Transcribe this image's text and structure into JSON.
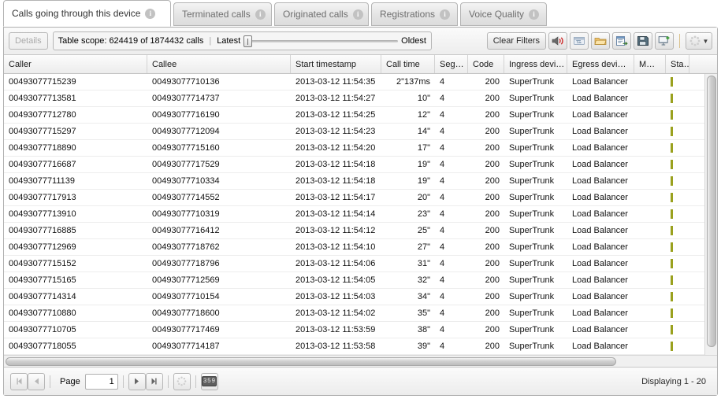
{
  "tabs": [
    {
      "label": "Calls going through this device",
      "active": true,
      "info_icon": "info-icon"
    },
    {
      "label": "Terminated calls",
      "active": false,
      "info_icon": "info-icon"
    },
    {
      "label": "Originated calls",
      "active": false,
      "info_icon": "info-icon"
    },
    {
      "label": "Registrations",
      "active": false,
      "info_icon": "info-icon"
    },
    {
      "label": "Voice Quality",
      "active": false,
      "info_icon": "info-icon"
    }
  ],
  "toolbar": {
    "details_label": "Details",
    "scope_label": "Table scope: 624419 of 1874432 calls",
    "latest_label": "Latest",
    "oldest_label": "Oldest",
    "clear_filters_label": "Clear Filters",
    "icons": [
      "speaker-icon",
      "refresh-print-icon",
      "folder-open-icon",
      "report-export-icon",
      "save-disk-icon",
      "export-chart-icon",
      "settings-spinner-icon"
    ]
  },
  "grid": {
    "columns": [
      {
        "label": "Caller",
        "key": "caller"
      },
      {
        "label": "Callee",
        "key": "callee"
      },
      {
        "label": "Start timestamp",
        "key": "start_timestamp"
      },
      {
        "label": "Call time",
        "key": "call_time"
      },
      {
        "label": "Seg…",
        "key": "segments"
      },
      {
        "label": "Code",
        "key": "code"
      },
      {
        "label": "Ingress devi…",
        "key": "ingress_device"
      },
      {
        "label": "Egress devi…",
        "key": "egress_device"
      },
      {
        "label": "M…",
        "key": "m"
      },
      {
        "label": "Sta…",
        "key": "status"
      }
    ],
    "rows": [
      {
        "caller": "00493077715239",
        "callee": "00493077710136",
        "start_timestamp": "2013-03-12 11:54:35",
        "call_time": "2\"137ms",
        "segments": "4",
        "code": "200",
        "ingress_device": "SuperTrunk",
        "egress_device": "Load Balancer",
        "m": "",
        "status": ""
      },
      {
        "caller": "00493077713581",
        "callee": "00493077714737",
        "start_timestamp": "2013-03-12 11:54:27",
        "call_time": "10\"",
        "segments": "4",
        "code": "200",
        "ingress_device": "SuperTrunk",
        "egress_device": "Load Balancer",
        "m": "",
        "status": ""
      },
      {
        "caller": "00493077712780",
        "callee": "00493077716190",
        "start_timestamp": "2013-03-12 11:54:25",
        "call_time": "12\"",
        "segments": "4",
        "code": "200",
        "ingress_device": "SuperTrunk",
        "egress_device": "Load Balancer",
        "m": "",
        "status": ""
      },
      {
        "caller": "00493077715297",
        "callee": "00493077712094",
        "start_timestamp": "2013-03-12 11:54:23",
        "call_time": "14\"",
        "segments": "4",
        "code": "200",
        "ingress_device": "SuperTrunk",
        "egress_device": "Load Balancer",
        "m": "",
        "status": ""
      },
      {
        "caller": "00493077718890",
        "callee": "00493077715160",
        "start_timestamp": "2013-03-12 11:54:20",
        "call_time": "17\"",
        "segments": "4",
        "code": "200",
        "ingress_device": "SuperTrunk",
        "egress_device": "Load Balancer",
        "m": "",
        "status": ""
      },
      {
        "caller": "00493077716687",
        "callee": "00493077717529",
        "start_timestamp": "2013-03-12 11:54:18",
        "call_time": "19\"",
        "segments": "4",
        "code": "200",
        "ingress_device": "SuperTrunk",
        "egress_device": "Load Balancer",
        "m": "",
        "status": ""
      },
      {
        "caller": "00493077711139",
        "callee": "00493077710334",
        "start_timestamp": "2013-03-12 11:54:18",
        "call_time": "19\"",
        "segments": "4",
        "code": "200",
        "ingress_device": "SuperTrunk",
        "egress_device": "Load Balancer",
        "m": "",
        "status": ""
      },
      {
        "caller": "00493077717913",
        "callee": "00493077714552",
        "start_timestamp": "2013-03-12 11:54:17",
        "call_time": "20\"",
        "segments": "4",
        "code": "200",
        "ingress_device": "SuperTrunk",
        "egress_device": "Load Balancer",
        "m": "",
        "status": ""
      },
      {
        "caller": "00493077713910",
        "callee": "00493077710319",
        "start_timestamp": "2013-03-12 11:54:14",
        "call_time": "23\"",
        "segments": "4",
        "code": "200",
        "ingress_device": "SuperTrunk",
        "egress_device": "Load Balancer",
        "m": "",
        "status": ""
      },
      {
        "caller": "00493077716885",
        "callee": "00493077716412",
        "start_timestamp": "2013-03-12 11:54:12",
        "call_time": "25\"",
        "segments": "4",
        "code": "200",
        "ingress_device": "SuperTrunk",
        "egress_device": "Load Balancer",
        "m": "",
        "status": ""
      },
      {
        "caller": "00493077712969",
        "callee": "00493077718762",
        "start_timestamp": "2013-03-12 11:54:10",
        "call_time": "27\"",
        "segments": "4",
        "code": "200",
        "ingress_device": "SuperTrunk",
        "egress_device": "Load Balancer",
        "m": "",
        "status": ""
      },
      {
        "caller": "00493077715152",
        "callee": "00493077718796",
        "start_timestamp": "2013-03-12 11:54:06",
        "call_time": "31\"",
        "segments": "4",
        "code": "200",
        "ingress_device": "SuperTrunk",
        "egress_device": "Load Balancer",
        "m": "",
        "status": ""
      },
      {
        "caller": "00493077715165",
        "callee": "00493077712569",
        "start_timestamp": "2013-03-12 11:54:05",
        "call_time": "32\"",
        "segments": "4",
        "code": "200",
        "ingress_device": "SuperTrunk",
        "egress_device": "Load Balancer",
        "m": "",
        "status": ""
      },
      {
        "caller": "00493077714314",
        "callee": "00493077710154",
        "start_timestamp": "2013-03-12 11:54:03",
        "call_time": "34\"",
        "segments": "4",
        "code": "200",
        "ingress_device": "SuperTrunk",
        "egress_device": "Load Balancer",
        "m": "",
        "status": ""
      },
      {
        "caller": "00493077710880",
        "callee": "00493077718600",
        "start_timestamp": "2013-03-12 11:54:02",
        "call_time": "35\"",
        "segments": "4",
        "code": "200",
        "ingress_device": "SuperTrunk",
        "egress_device": "Load Balancer",
        "m": "",
        "status": ""
      },
      {
        "caller": "00493077710705",
        "callee": "00493077717469",
        "start_timestamp": "2013-03-12 11:53:59",
        "call_time": "38\"",
        "segments": "4",
        "code": "200",
        "ingress_device": "SuperTrunk",
        "egress_device": "Load Balancer",
        "m": "",
        "status": ""
      },
      {
        "caller": "00493077718055",
        "callee": "00493077714187",
        "start_timestamp": "2013-03-12 11:53:58",
        "call_time": "39\"",
        "segments": "4",
        "code": "200",
        "ingress_device": "SuperTrunk",
        "egress_device": "Load Balancer",
        "m": "",
        "status": ""
      }
    ]
  },
  "pager": {
    "page_label": "Page",
    "page_value": "1",
    "counter_icon_label": "359",
    "displaying_label": "Displaying 1 - 20",
    "icons": [
      "first-page-icon",
      "prev-page-icon",
      "next-page-icon",
      "last-page-icon",
      "refresh-spinner-icon",
      "counter-icon"
    ]
  },
  "colors": {
    "status_green": "#9aa11e",
    "tab_border": "#b4b4b4",
    "panel_border": "#b0b0b0"
  }
}
